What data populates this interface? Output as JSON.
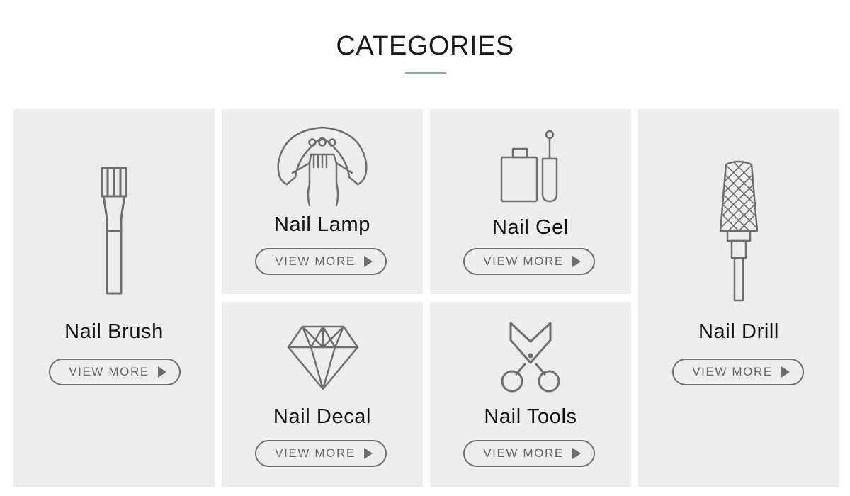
{
  "section": {
    "title": "CATEGORIES",
    "accent_color": "#8fa898"
  },
  "categories": [
    {
      "name": "Nail Brush",
      "icon": "brush-icon",
      "button_label": "VIEW MORE"
    },
    {
      "name": "Nail Lamp",
      "icon": "nail-lamp-icon",
      "button_label": "VIEW MORE"
    },
    {
      "name": "Nail Gel",
      "icon": "gel-bottle-icon",
      "button_label": "VIEW MORE"
    },
    {
      "name": "Nail Drill",
      "icon": "drill-bit-icon",
      "button_label": "VIEW MORE"
    },
    {
      "name": "Nail Decal",
      "icon": "diamond-icon",
      "button_label": "VIEW MORE"
    },
    {
      "name": "Nail Tools",
      "icon": "scissors-icon",
      "button_label": "VIEW MORE"
    }
  ],
  "colors": {
    "card_background": "#ededed",
    "icon_stroke": "#6e6e6e",
    "text": "#111111"
  }
}
